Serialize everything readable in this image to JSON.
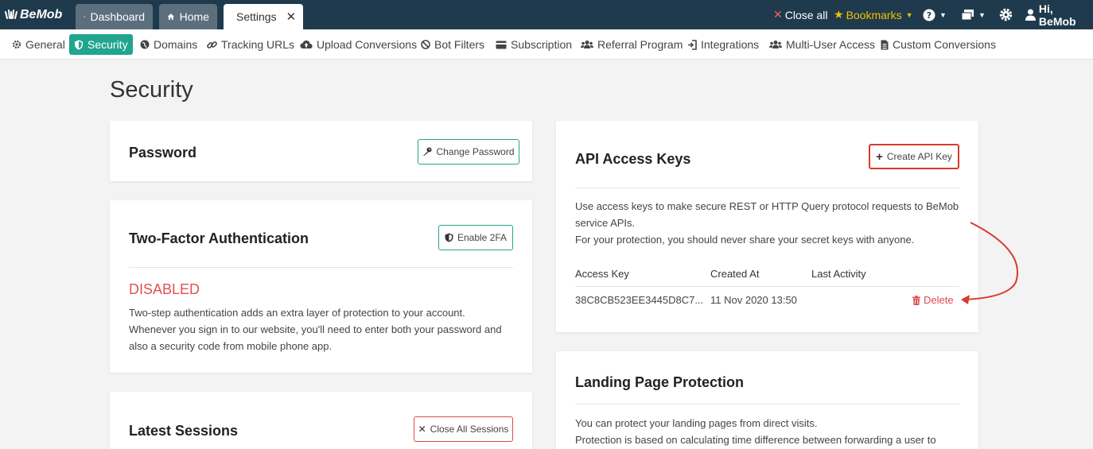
{
  "topbar": {
    "logo": "BeMob",
    "tabs": [
      {
        "label": "Dashboard"
      },
      {
        "label": "Home"
      },
      {
        "label": "Settings"
      }
    ],
    "close_all": "Close all",
    "bookmarks": "Bookmarks",
    "user": "Hi, BeMob"
  },
  "subnav": {
    "items": [
      {
        "label": "General"
      },
      {
        "label": "Security"
      },
      {
        "label": "Domains"
      },
      {
        "label": "Tracking URLs"
      },
      {
        "label": "Upload Conversions"
      },
      {
        "label": "Bot Filters"
      },
      {
        "label": "Subscription"
      },
      {
        "label": "Referral Program"
      },
      {
        "label": "Integrations"
      },
      {
        "label": "Multi-User Access"
      },
      {
        "label": "Custom Conversions"
      }
    ],
    "active_color": "#22a58f"
  },
  "page": {
    "title": "Security"
  },
  "password_card": {
    "title": "Password",
    "button": "Change Password"
  },
  "twofa_card": {
    "title": "Two-Factor Authentication",
    "button": "Enable 2FA",
    "status": "DISABLED",
    "description_lines": [
      "Two-step authentication adds an extra layer of protection to your account.",
      "Whenever you sign in to our website, you'll need to enter both your password and",
      "also a security code from mobile phone app."
    ]
  },
  "sessions_card": {
    "title": "Latest Sessions",
    "button": "Close All Sessions"
  },
  "api_card": {
    "title": "API Access Keys",
    "button": "Create API Key",
    "description_lines": [
      "Use access keys to make secure REST or HTTP Query protocol requests to BeMob",
      "service APIs.",
      "For your protection, you should never share your secret keys with anyone."
    ],
    "columns": [
      "Access Key",
      "Created At",
      "Last Activity"
    ],
    "rows": [
      {
        "key": "38C8CB523EE3445D8C7...",
        "created": "11 Nov 2020 13:50",
        "last_activity": "",
        "action": "Delete"
      }
    ]
  },
  "landing_card": {
    "title": "Landing Page Protection",
    "description_lines": [
      "You can protect your landing pages from direct visits.",
      "Protection is based on calculating time difference between forwarding a user to"
    ]
  },
  "colors": {
    "topbar": "#1f3a4d",
    "accent": "#22a58f",
    "danger": "#e04a4a",
    "highlight": "#d93a2b",
    "bookmarks": "#f2c200"
  }
}
